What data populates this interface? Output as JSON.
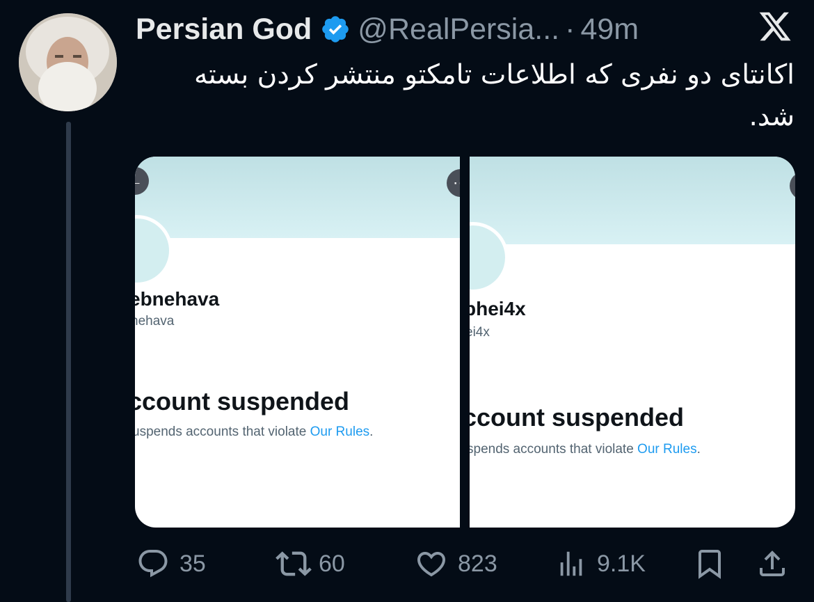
{
  "tweet": {
    "author": {
      "display_name": "Persian God",
      "handle": "@RealPersia...",
      "verified": true
    },
    "separator": "·",
    "time": "49m",
    "text": "اکانتای دو نفری که اطلاعات تامکتو منتشر کردن بسته شد."
  },
  "media": {
    "screenshots": [
      {
        "name": "ebnehava",
        "handle": "nehava",
        "status_title": "ccount suspended",
        "status_text": "uspends accounts that violate ",
        "rules_link": "Our Rules",
        "rules_end": "."
      },
      {
        "name": "phei4x",
        "handle": "ei4x",
        "status_title": "ccount suspended",
        "status_text": "spends accounts that violate ",
        "rules_link": "Our Rules",
        "rules_end": "."
      }
    ]
  },
  "actions": {
    "replies": "35",
    "reposts": "60",
    "likes": "823",
    "views": "9.1K"
  },
  "colors": {
    "background": "#040c16",
    "text": "#e7e9ea",
    "muted": "#8b98a5",
    "verified": "#1d9bf0",
    "link": "#1d9bf0"
  },
  "icons": [
    "verified-badge-icon",
    "x-logo-icon",
    "reply-icon",
    "repost-icon",
    "like-icon",
    "views-icon",
    "bookmark-icon",
    "share-icon"
  ]
}
